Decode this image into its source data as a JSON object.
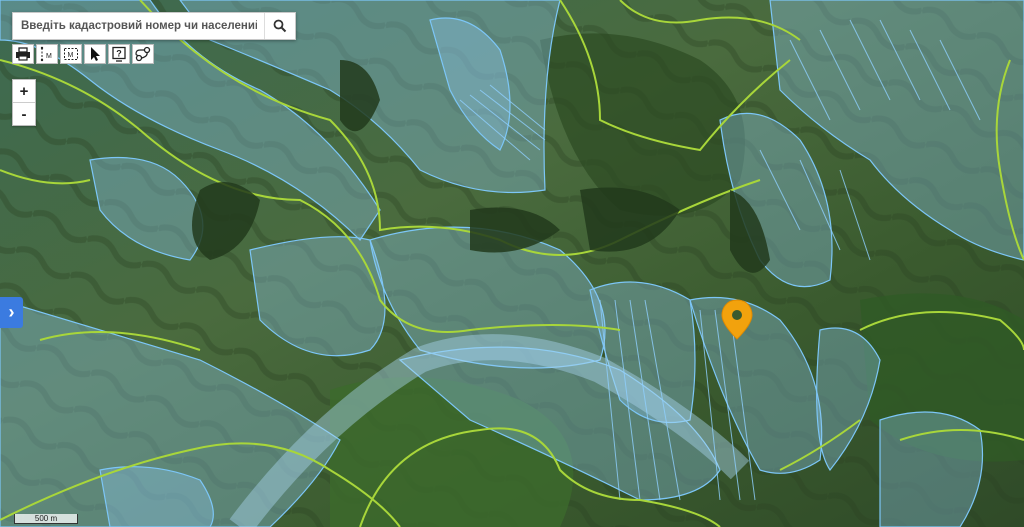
{
  "search": {
    "placeholder": "Введіть кадастровий номер чи населений пункт"
  },
  "toolbar": {
    "tools": [
      {
        "name": "print-icon"
      },
      {
        "name": "measure-distance-icon",
        "label": "M"
      },
      {
        "name": "measure-area-icon",
        "label": "M"
      },
      {
        "name": "pointer-icon"
      },
      {
        "name": "info-icon",
        "label": "?"
      },
      {
        "name": "route-icon"
      }
    ]
  },
  "zoom": {
    "in": "+",
    "out": "-"
  },
  "side_toggle": {
    "label": "›"
  },
  "scale": {
    "label": "500 m"
  },
  "colors": {
    "parcel_fill": "#8ec9f0",
    "parcel_stroke": "#7cc6f7",
    "boundary_line": "#a8d63a",
    "marker": "#f2a20d",
    "toggle": "#3b7be0"
  }
}
